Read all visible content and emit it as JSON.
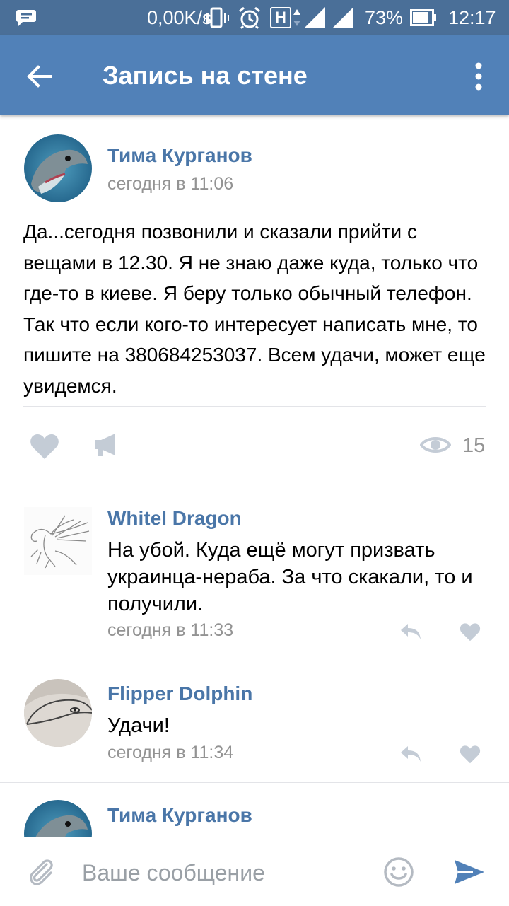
{
  "status_bar": {
    "net_speed": "0,00K/s",
    "network_type": "H",
    "battery": "73%",
    "clock": "12:17"
  },
  "header": {
    "title": "Запись на стене",
    "back_icon": "arrow-left-icon",
    "menu_icon": "more-vertical-icon"
  },
  "post": {
    "author": "Тима Курганов",
    "time": "сегодня в 11:06",
    "text": "Да...сегодня позвонили и сказали прийти с вещами в 12.30. Я не знаю даже куда, только что где-то в киеве. Я беру только обычный телефон. Так что если кого-то интересует написать мне, то пишите на 380684253037. Всем удачи, может еще увидемся.",
    "views": "15",
    "like_icon": "heart-icon",
    "share_icon": "megaphone-icon",
    "views_icon": "eye-icon"
  },
  "comments": [
    {
      "author": "Whitel Dragon",
      "text": "На убой. Куда ещё могут призвать украинца-нераба. За что скакали, то и получили.",
      "time": "сегодня в 11:33"
    },
    {
      "author": "Flipper Dolphin",
      "text": "Удачи!",
      "time": "сегодня в 11:34"
    },
    {
      "author": "Тима Курганов"
    }
  ],
  "composer": {
    "placeholder": "Ваше сообщение",
    "attach_icon": "paperclip-icon",
    "emoji_icon": "smile-icon",
    "send_icon": "send-icon"
  },
  "colors": {
    "status_bar": "#4a6f98",
    "app_bar": "#5181b8",
    "link": "#4a76a8",
    "muted": "#939393",
    "icon": "#c4ccd6",
    "send": "#5181b8"
  }
}
